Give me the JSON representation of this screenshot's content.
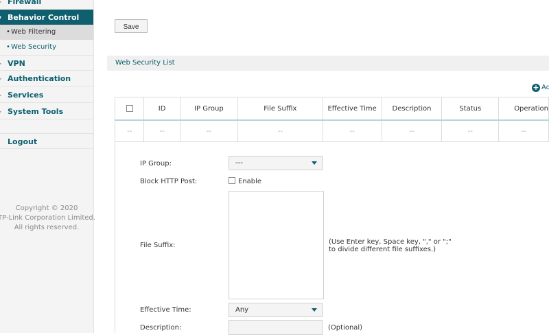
{
  "sidebar": {
    "items": [
      {
        "label": "Firewall"
      },
      {
        "label": "Behavior Control"
      },
      {
        "label": "VPN"
      },
      {
        "label": "Authentication"
      },
      {
        "label": "Services"
      },
      {
        "label": "System Tools"
      }
    ],
    "subitems": [
      {
        "label": "Web Filtering"
      },
      {
        "label": "Web Security"
      }
    ],
    "logout": "Logout",
    "copyright": [
      "Copyright © 2020",
      "TP-Link Corporation Limited.",
      "All rights reserved."
    ]
  },
  "toolbar": {
    "save_label": "Save"
  },
  "section": {
    "title": "Web Security List",
    "add_label": "Add"
  },
  "table": {
    "headers": [
      "ID",
      "IP Group",
      "File Suffix",
      "Effective Time",
      "Description",
      "Status",
      "Operation"
    ],
    "row": [
      "--",
      "--",
      "--",
      "--",
      "--",
      "--",
      "--",
      "--"
    ]
  },
  "form": {
    "ip_group_label": "IP Group:",
    "ip_group_value": "---",
    "block_http_label": "Block HTTP Post:",
    "enable_label": "Enable",
    "file_suffix_label": "File Suffix:",
    "file_suffix_hint_1": "(Use Enter key, Space key, \",\" or \";\"",
    "file_suffix_hint_2": "to divide different file suffixes.)",
    "effective_time_label": "Effective Time:",
    "effective_time_value": "Any",
    "description_label": "Description:",
    "optional_label": "(Optional)"
  },
  "colors": {
    "accent": "#0f5f6e",
    "sidebar_bg": "#f4f4f4"
  }
}
